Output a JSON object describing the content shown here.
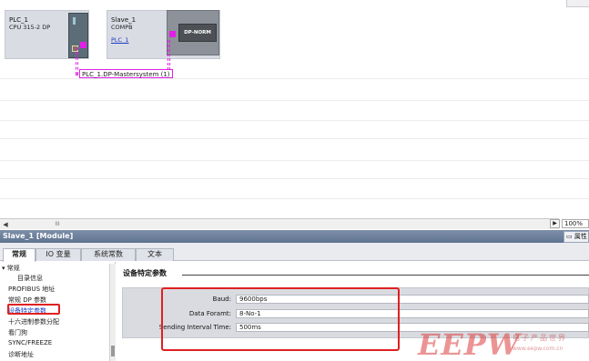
{
  "network": {
    "plc": {
      "name": "PLC_1",
      "type": "CPU 315-2 DP"
    },
    "slave": {
      "name": "Slave_1",
      "type": "COMPB",
      "link": "PLC_1",
      "module_label": "DP-NORM"
    },
    "bus_label": "PLC_1.DP-Mastersystem (1)"
  },
  "zoom": "100%",
  "scroll_grip": "III",
  "inspector": {
    "title": "Slave_1 [Module]",
    "properties_tab": "属性",
    "tabs": [
      {
        "label": "常规",
        "active": true
      },
      {
        "label": "IO 变量",
        "active": false
      },
      {
        "label": "系统常数",
        "active": false
      },
      {
        "label": "文本",
        "active": false
      }
    ]
  },
  "tree": {
    "root": "常规",
    "items": [
      "目录信息",
      "PROFIBUS 地址",
      "常规 DP 参数",
      "设备特定参数",
      "十六进制参数分配",
      "看门狗",
      "SYNC/FREEZE",
      "诊断地址"
    ],
    "selected_index": 3
  },
  "params": {
    "section_title": "设备特定参数",
    "rows": [
      {
        "label": "Baud:",
        "value": "9600bps"
      },
      {
        "label": "Data Foramt:",
        "value": "8-No-1"
      },
      {
        "label": "Sending Interval Time:",
        "value": "500ms"
      }
    ]
  },
  "watermark": {
    "brand": "EEPW",
    "tagline": "电子产品世界",
    "url": "www.eepw.com.cn"
  },
  "colors": {
    "bus": "#e21fe8",
    "highlight": "#e02020",
    "inspector_header": "#6b7d98"
  }
}
